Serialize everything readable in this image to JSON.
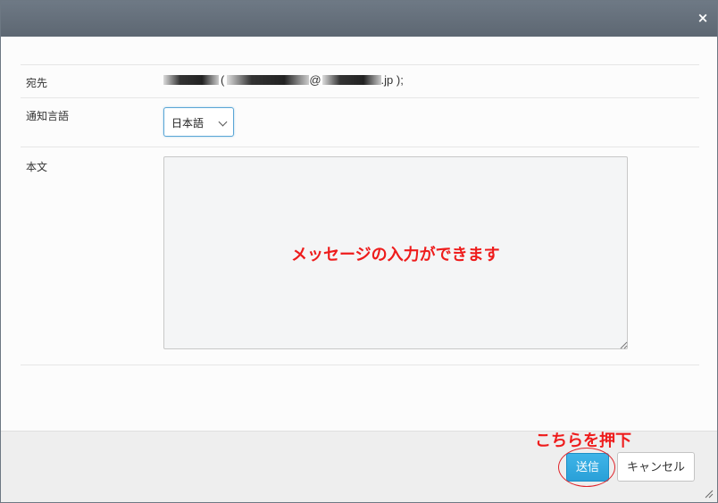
{
  "dialog": {
    "close_glyph": "×"
  },
  "form": {
    "recipient": {
      "label": "宛先",
      "open_paren": "(",
      "at": "@",
      "domain_suffix": ".jp );"
    },
    "language": {
      "label": "通知言語",
      "selected": "日本語"
    },
    "body": {
      "label": "本文",
      "value": ""
    }
  },
  "annotations": {
    "message_hint": "メッセージの入力ができます",
    "press_hint": "こちらを押下",
    "highlight_color": "#e0242a",
    "text_color": "#ee1c1c"
  },
  "footer": {
    "send_label": "送信",
    "cancel_label": "キャンセル"
  },
  "colors": {
    "titlebar": "#5d6772",
    "primary": "#2aa0d8"
  }
}
